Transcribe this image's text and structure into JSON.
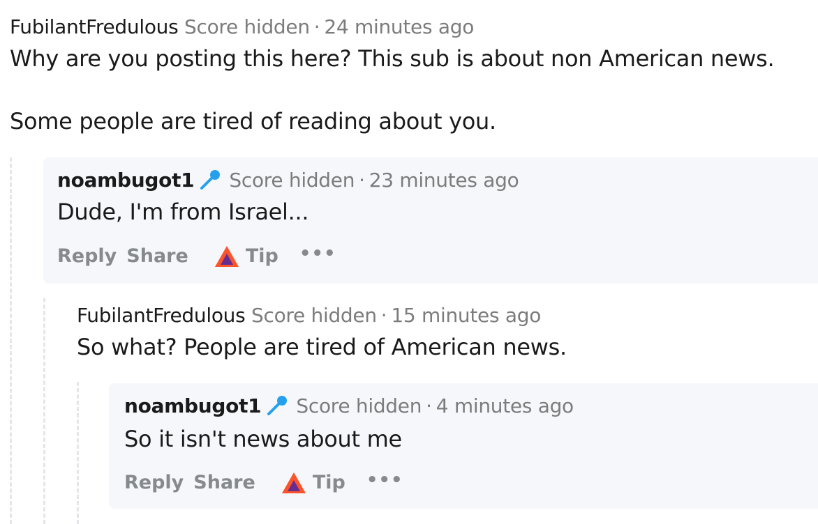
{
  "colors": {
    "card_bg": "#f5f7fb",
    "meta_grey": "#7c7c7c",
    "action_grey": "#878a8c",
    "mic_blue": "#24a0ed",
    "tip_orange": "#fb542b",
    "tip_purple": "#662d91"
  },
  "comments": [
    {
      "username": "FubilantFredulous",
      "score": "Score hidden",
      "separator": "·",
      "time": "24 minutes ago",
      "paragraphs": [
        "Why are you posting this here? This sub is about non American news.",
        "Some people are tired of reading about you."
      ]
    },
    {
      "username": "noambugot1",
      "flair_icon": "microphone-icon",
      "score": "Score hidden",
      "separator": "·",
      "time": "23 minutes ago",
      "paragraphs": [
        "Dude, I'm from Israel..."
      ],
      "actions": {
        "reply": "Reply",
        "share": "Share",
        "tip": "Tip",
        "more": "•••"
      }
    },
    {
      "username": "FubilantFredulous",
      "score": "Score hidden",
      "separator": "·",
      "time": "15 minutes ago",
      "paragraphs": [
        "So what? People are tired of American news."
      ]
    },
    {
      "username": "noambugot1",
      "flair_icon": "microphone-icon",
      "score": "Score hidden",
      "separator": "·",
      "time": "4 minutes ago",
      "paragraphs": [
        "So it isn't news about me"
      ],
      "actions": {
        "reply": "Reply",
        "share": "Share",
        "tip": "Tip",
        "more": "•••"
      }
    }
  ]
}
